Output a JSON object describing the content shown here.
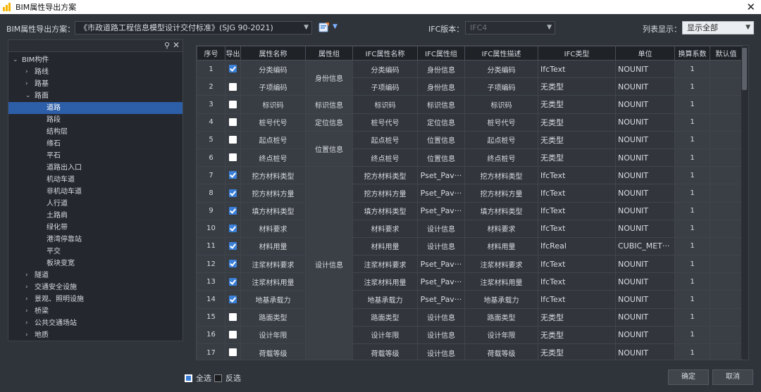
{
  "window": {
    "title": "BIM属性导出方案",
    "close_glyph": "✕"
  },
  "toolbar": {
    "scheme_label": "BIM属性导出方案：",
    "scheme_value": "《市政道路工程信息模型设计交付标准》(SJG 90-2021)",
    "ifc_version_label": "IFC版本：",
    "ifc_version_value": "IFC4",
    "list_display_label": "列表显示：",
    "list_display_value": "显示全部"
  },
  "tree": [
    {
      "label": "BIM构件",
      "level": 0,
      "expanded": true
    },
    {
      "label": "路线",
      "level": 1,
      "expanded": false
    },
    {
      "label": "路基",
      "level": 1,
      "expanded": false
    },
    {
      "label": "路面",
      "level": 1,
      "expanded": true
    },
    {
      "label": "道路",
      "level": 2,
      "selected": true
    },
    {
      "label": "路段",
      "level": 2
    },
    {
      "label": "结构层",
      "level": 2
    },
    {
      "label": "缘石",
      "level": 2
    },
    {
      "label": "平石",
      "level": 2
    },
    {
      "label": "道路出入口",
      "level": 2
    },
    {
      "label": "机动车道",
      "level": 2
    },
    {
      "label": "非机动车道",
      "level": 2
    },
    {
      "label": "人行道",
      "level": 2
    },
    {
      "label": "土路肩",
      "level": 2
    },
    {
      "label": "绿化带",
      "level": 2
    },
    {
      "label": "港湾停靠站",
      "level": 2
    },
    {
      "label": "平交",
      "level": 2
    },
    {
      "label": "板块变宽",
      "level": 2
    },
    {
      "label": "隧道",
      "level": 1,
      "expanded": false
    },
    {
      "label": "交通安全设施",
      "level": 1,
      "expanded": false
    },
    {
      "label": "景观、照明设施",
      "level": 1,
      "expanded": false
    },
    {
      "label": "桥梁",
      "level": 1,
      "expanded": false
    },
    {
      "label": "公共交通场站",
      "level": 1,
      "expanded": false
    },
    {
      "label": "地质",
      "level": 1,
      "expanded": false
    }
  ],
  "table": {
    "columns": [
      "序号",
      "导出",
      "属性名称",
      "属性组",
      "IFC属性名称",
      "IFC属性组",
      "IFC属性描述",
      "IFC类型",
      "单位",
      "换算系数",
      "默认值"
    ],
    "rows": [
      {
        "no": "1",
        "export": true,
        "name": "分类编码",
        "ifc_name": "分类编码",
        "ifc_group": "身份信息",
        "ifc_desc": "分类编码",
        "ifc_type": "IfcText",
        "unit": "NOUNIT",
        "coef": "1",
        "default": ""
      },
      {
        "no": "2",
        "export": false,
        "name": "子项编码",
        "ifc_name": "子项编码",
        "ifc_group": "身份信息",
        "ifc_desc": "子项编码",
        "ifc_type": "无类型",
        "unit": "NOUNIT",
        "coef": "1",
        "default": ""
      },
      {
        "no": "3",
        "export": false,
        "name": "标识码",
        "ifc_name": "标识码",
        "ifc_group": "标识信息",
        "ifc_desc": "标识码",
        "ifc_type": "无类型",
        "unit": "NOUNIT",
        "coef": "1",
        "default": ""
      },
      {
        "no": "4",
        "export": false,
        "name": "桩号代号",
        "ifc_name": "桩号代号",
        "ifc_group": "定位信息",
        "ifc_desc": "桩号代号",
        "ifc_type": "无类型",
        "unit": "NOUNIT",
        "coef": "1",
        "default": ""
      },
      {
        "no": "5",
        "export": false,
        "name": "起点桩号",
        "ifc_name": "起点桩号",
        "ifc_group": "位置信息",
        "ifc_desc": "起点桩号",
        "ifc_type": "无类型",
        "unit": "NOUNIT",
        "coef": "1",
        "default": ""
      },
      {
        "no": "6",
        "export": false,
        "name": "终点桩号",
        "ifc_name": "终点桩号",
        "ifc_group": "位置信息",
        "ifc_desc": "终点桩号",
        "ifc_type": "无类型",
        "unit": "NOUNIT",
        "coef": "1",
        "default": ""
      },
      {
        "no": "7",
        "export": true,
        "name": "挖方材料类型",
        "ifc_name": "挖方材料类型",
        "ifc_group": "Pset_Pav···",
        "ifc_desc": "挖方材料类型",
        "ifc_type": "IfcText",
        "unit": "NOUNIT",
        "coef": "1",
        "default": ""
      },
      {
        "no": "8",
        "export": true,
        "name": "挖方材料方量",
        "ifc_name": "挖方材料方量",
        "ifc_group": "Pset_Pav···",
        "ifc_desc": "挖方材料方量",
        "ifc_type": "IfcText",
        "unit": "NOUNIT",
        "coef": "1",
        "default": ""
      },
      {
        "no": "9",
        "export": true,
        "name": "填方材料类型",
        "ifc_name": "填方材料类型",
        "ifc_group": "Pset_Pav···",
        "ifc_desc": "填方材料类型",
        "ifc_type": "IfcText",
        "unit": "NOUNIT",
        "coef": "1",
        "default": ""
      },
      {
        "no": "10",
        "export": true,
        "name": "材料要求",
        "ifc_name": "材料要求",
        "ifc_group": "设计信息",
        "ifc_desc": "材料要求",
        "ifc_type": "IfcText",
        "unit": "NOUNIT",
        "coef": "1",
        "default": ""
      },
      {
        "no": "11",
        "export": true,
        "name": "材料用量",
        "ifc_name": "材料用量",
        "ifc_group": "设计信息",
        "ifc_desc": "材料用量",
        "ifc_type": "IfcReal",
        "unit": "CUBIC_MET···",
        "coef": "1",
        "default": ""
      },
      {
        "no": "12",
        "export": true,
        "name": "注浆材料要求",
        "ifc_name": "注浆材料要求",
        "ifc_group": "Pset_Pav···",
        "ifc_desc": "注浆材料要求",
        "ifc_type": "IfcText",
        "unit": "NOUNIT",
        "coef": "1",
        "default": ""
      },
      {
        "no": "13",
        "export": true,
        "name": "注浆材料用量",
        "ifc_name": "注浆材料用量",
        "ifc_group": "Pset_Pav···",
        "ifc_desc": "注浆材料用量",
        "ifc_type": "IfcText",
        "unit": "NOUNIT",
        "coef": "1",
        "default": ""
      },
      {
        "no": "14",
        "export": true,
        "name": "地基承载力",
        "ifc_name": "地基承载力",
        "ifc_group": "Pset_Pav···",
        "ifc_desc": "地基承载力",
        "ifc_type": "IfcText",
        "unit": "NOUNIT",
        "coef": "1",
        "default": ""
      },
      {
        "no": "15",
        "export": false,
        "name": "路面类型",
        "ifc_name": "路面类型",
        "ifc_group": "设计信息",
        "ifc_desc": "路面类型",
        "ifc_type": "无类型",
        "unit": "NOUNIT",
        "coef": "1",
        "default": ""
      },
      {
        "no": "16",
        "export": false,
        "name": "设计年限",
        "ifc_name": "设计年限",
        "ifc_group": "设计信息",
        "ifc_desc": "设计年限",
        "ifc_type": "无类型",
        "unit": "NOUNIT",
        "coef": "1",
        "default": ""
      },
      {
        "no": "17",
        "export": false,
        "name": "荷载等级",
        "ifc_name": "荷载等级",
        "ifc_group": "设计信息",
        "ifc_desc": "荷载等级",
        "ifc_type": "无类型",
        "unit": "NOUNIT",
        "coef": "1",
        "default": ""
      }
    ],
    "groups": [
      {
        "label": "身份信息",
        "rowspan": 2
      },
      {
        "label": "标识信息",
        "rowspan": 1
      },
      {
        "label": "定位信息",
        "rowspan": 1
      },
      {
        "label": "位置信息",
        "rowspan": 2
      },
      {
        "label": "设计信息",
        "rowspan": 11
      }
    ]
  },
  "footer": {
    "select_all_label": "全选",
    "invert_label": "反选",
    "ok_label": "确定",
    "cancel_label": "取消"
  },
  "colors": {
    "accent": "#3a7fd8",
    "background": "#2f333a",
    "selected_row": "#2d5ea8"
  }
}
